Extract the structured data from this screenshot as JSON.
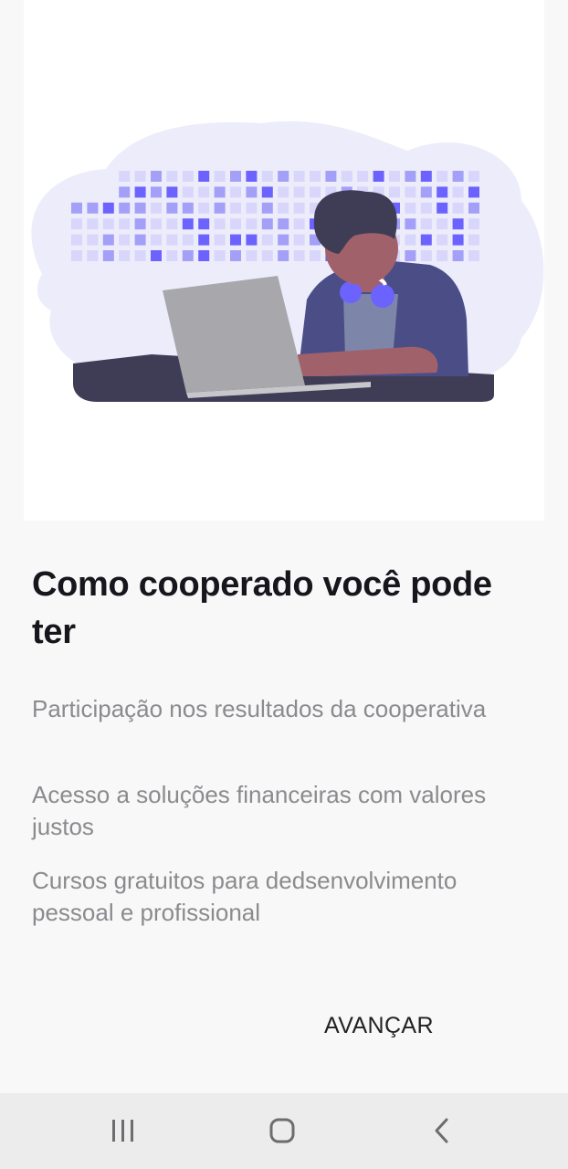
{
  "onboarding": {
    "title": "Como cooperado você pode ter",
    "benefits": [
      "Participação nos resultados da cooperativa",
      "Acesso a soluções financeiras com valores justos",
      "Cursos gratuitos para dedsenvolvimento pessoal e profissional"
    ],
    "next_label": "AVANÇAR"
  },
  "illustration": {
    "subject": "person-working-on-laptop",
    "colors": {
      "cloud": "#ececfb",
      "tile_light": "#d8d6fb",
      "tile_mid": "#a49ff7",
      "tile_dark": "#6c63ff",
      "hair": "#3f3d56",
      "skin": "#a0616a",
      "jacket": "#4b4d86",
      "shirt": "#7d86a8",
      "headphones": "#6c63ff",
      "laptop": "#a8a8ac",
      "desk": "#3f3d56"
    }
  },
  "navbar": {
    "recent_icon": "recent-apps-icon",
    "home_icon": "home-icon",
    "back_icon": "back-icon"
  },
  "colors": {
    "background": "#f8f8f8",
    "title": "#16161c",
    "body_text": "#8b8b8f",
    "navbar": "#ececec"
  }
}
